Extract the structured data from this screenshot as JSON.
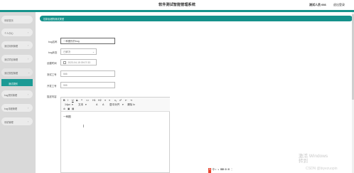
{
  "header": {
    "title": "软件测试智能管理系统",
    "user": "测试人员 666",
    "logout": "退出登录"
  },
  "sidebar": {
    "items": [
      {
        "label": "系统首页"
      },
      {
        "label": "个人中心"
      },
      {
        "label": "测试用例管理"
      },
      {
        "label": "测试项目管理"
      },
      {
        "label": "测试类型管理"
      },
      {
        "label": "bug类别管理"
      },
      {
        "label": "bug详细管理"
      },
      {
        "label": "系统管理"
      }
    ],
    "active_sub": "测试类别"
  },
  "breadcrumb": {
    "home": "控制台首页",
    "separator": "/",
    "current": "测试类型"
  },
  "form": {
    "bug_name_label": "bug名称",
    "bug_name_value": "一种图形的bug",
    "bug_status_label": "bug状态",
    "bug_status_value": "已解决",
    "resolve_time_label": "创建时间",
    "resolve_time_value": "2023-04-15 09:07:33",
    "tester_id_label": "测试工号",
    "tester_id_value": "666",
    "developer_id_label": "开发工号",
    "developer_id_value": "555",
    "bug_content_label": "描述内容"
  },
  "editor": {
    "row1": [
      "B",
      "I",
      "U",
      "S",
      "❝",
      "<>",
      "H1",
      "H2",
      "≡",
      "≡",
      "x₂",
      "x²",
      "⇤",
      "⇥"
    ],
    "row2": [
      "14px",
      "▾",
      "文本",
      "▾",
      "A",
      "A",
      "居中对齐",
      "▾",
      "清除",
      "Ix"
    ],
    "row3": [
      "⊘",
      "▣",
      "▤"
    ],
    "content": "一种图"
  },
  "overlay": {
    "activate_windows": [
      "激活 Windows",
      "转到"
    ],
    "csdn": "CSDN @biyezuopin"
  },
  "ime": [
    "S",
    "中",
    "•",
    "ゝ",
    "⌨",
    "⚙",
    "⊞",
    "⋮"
  ],
  "colors": {
    "accent": "#17948c",
    "sidebar_bg": "#d9d9d9",
    "active_item": "#1b9a95"
  }
}
